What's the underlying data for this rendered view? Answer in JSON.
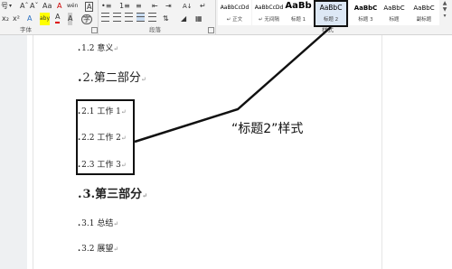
{
  "ribbon": {
    "font_row1": {
      "size_box": "号",
      "grow": "Aˆ",
      "shrink": "Aˇ",
      "case": "Aa",
      "clear": "A",
      "phonetic": "wén",
      "border": "A"
    },
    "font_row2": {
      "subscript": "x₂",
      "superscript": "x²",
      "effects": "A",
      "highlight": "aby",
      "font_color": "A",
      "shading": "A",
      "enclose": "字"
    },
    "para_row1": {
      "sort": "A↓",
      "marks": "↵"
    },
    "group_labels": {
      "font": "字体",
      "paragraph": "段落",
      "styles": "样式"
    },
    "styles": [
      {
        "sample": "AaBbCcDd",
        "name": "↵ 正文"
      },
      {
        "sample": "AaBbCcDd",
        "name": "↵ 无间隔"
      },
      {
        "sample": "AaBb",
        "name": "标题 1"
      },
      {
        "sample": "AaBbC",
        "name": "标题 2"
      },
      {
        "sample": "AaBbC",
        "name": "标题 3"
      },
      {
        "sample": "AaBbC",
        "name": "标题"
      },
      {
        "sample": "AaBbC",
        "name": "副标题"
      }
    ]
  },
  "document": {
    "lines": [
      {
        "bullet": ".",
        "text": "1.2 意义",
        "mark": "↵"
      },
      {
        "bullet": ".",
        "text": "2.第二部分",
        "mark": "↵"
      },
      {
        "bullet": ".",
        "text": "2.1 工作 1",
        "mark": "↵"
      },
      {
        "bullet": ".",
        "text": "2.2 工作 2",
        "mark": "↵"
      },
      {
        "bullet": ".",
        "text": "2.3 工作 3",
        "mark": "↵"
      },
      {
        "bullet": ".",
        "text": "3.第三部分",
        "mark": "↵"
      },
      {
        "bullet": ".",
        "text": "3.1 总结",
        "mark": "↵"
      },
      {
        "bullet": ".",
        "text": "3.2 展望",
        "mark": "↵"
      }
    ]
  },
  "annotation": {
    "caption": "“标题2”样式"
  },
  "colors": {
    "ribbon_bg": "#f3f3f3",
    "selected_style": "#c9dcf2",
    "callout": "#111111"
  },
  "icons": [
    "bold-icon",
    "italic-icon",
    "underline-icon",
    "bullets-icon",
    "numbering-icon",
    "multilevel-icon",
    "decrease-indent-icon",
    "increase-indent-icon",
    "align-left-icon",
    "align-center-icon",
    "align-right-icon",
    "justify-icon",
    "line-spacing-icon",
    "gallery-scroll-icon",
    "dialog-launcher-icon"
  ]
}
